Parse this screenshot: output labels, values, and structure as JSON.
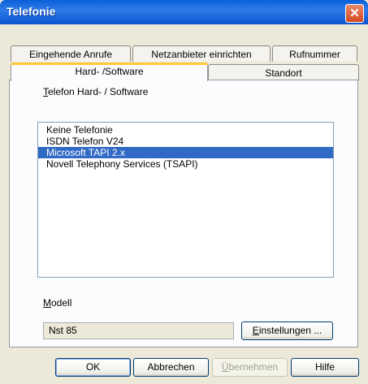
{
  "window": {
    "title": "Telefonie"
  },
  "tabs": [
    {
      "label": "Eingehende Anrufe"
    },
    {
      "label": "Netzanbieter einrichten"
    },
    {
      "label": "Rufnummer"
    },
    {
      "label": "Hard- /Software"
    },
    {
      "label": "Standort"
    }
  ],
  "panel": {
    "group_label": "Telefon Hard- / Software",
    "list": {
      "items": [
        "Keine Telefonie",
        "ISDN Telefon V24",
        "Microsoft TAPI 2.x",
        "Novell Telephony Services (TSAPI)"
      ],
      "selected": "Microsoft TAPI 2.x"
    },
    "model_label": "Modell",
    "model_value": "Nst 85",
    "settings_button": "Einstellungen ..."
  },
  "buttons": {
    "ok": "OK",
    "cancel": "Abbrechen",
    "apply": "Übernehmen",
    "help": "Hilfe"
  },
  "colors": {
    "titlebar": "#0a5fd8",
    "selection": "#316ac5",
    "active_tab_accent": "#ffc83c"
  },
  "icons": {
    "close": "close-icon"
  }
}
